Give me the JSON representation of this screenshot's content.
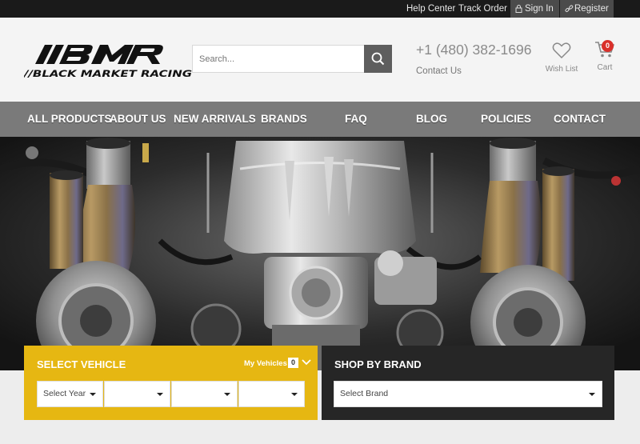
{
  "topbar": {
    "help": "Help Center",
    "track": "Track Order",
    "signin": "Sign In",
    "register": "Register"
  },
  "header": {
    "logo_text": "//BLACK MARKET RACING",
    "logo_mark": "BMR",
    "search_placeholder": "Search...",
    "phone": "+1 (480) 382-1696",
    "contact": "Contact Us",
    "wishlist": "Wish List",
    "cart": "Cart",
    "cart_count": "0"
  },
  "nav": {
    "items": [
      "ALL PRODUCTS",
      "ABOUT US",
      "NEW ARRIVALS",
      "BRANDS",
      "FAQ",
      "BLOG",
      "POLICIES",
      "CONTACT"
    ]
  },
  "vehicle": {
    "title": "SELECT VEHICLE",
    "my_vehicles": "My Vehicles",
    "my_vehicles_count": "0",
    "year_placeholder": "Select Year"
  },
  "brand": {
    "title": "SHOP BY BRAND",
    "placeholder": "Select Brand"
  },
  "colors": {
    "accent_yellow": "#e6b712",
    "nav_gray": "#7a7a7a",
    "dark": "#262626",
    "badge_red": "#d9302a"
  },
  "icons": {
    "signin": "lock-icon",
    "register": "link-icon",
    "search": "search-icon",
    "wishlist": "heart-icon",
    "cart": "cart-icon",
    "dropdown": "chevron-down-icon"
  }
}
